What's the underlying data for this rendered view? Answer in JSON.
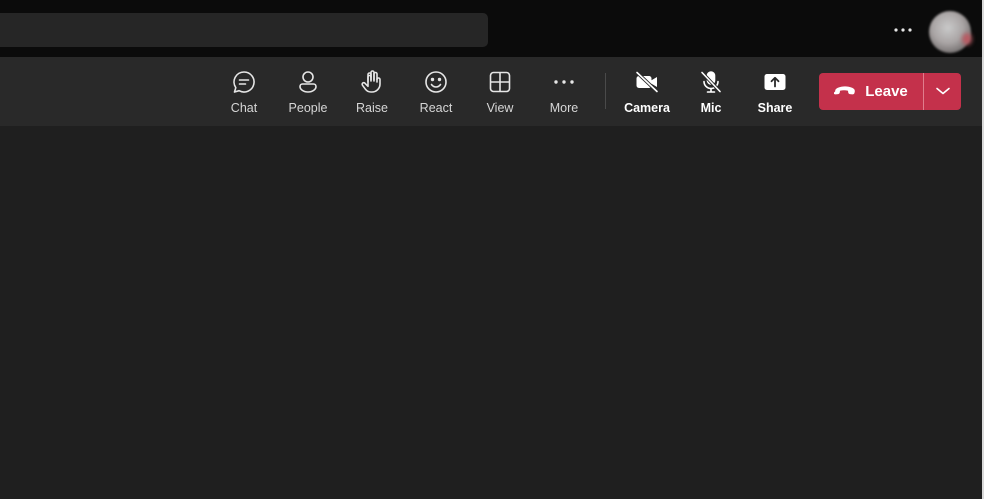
{
  "title_bar": {
    "search": {
      "value": "",
      "placeholder": ""
    },
    "more_icon": "ellipsis-icon",
    "avatar_icon": "profile-avatar"
  },
  "toolbar": {
    "tools": [
      {
        "label": "Chat",
        "icon": "chat-icon"
      },
      {
        "label": "People",
        "icon": "people-icon"
      },
      {
        "label": "Raise",
        "icon": "raise-hand-icon"
      },
      {
        "label": "React",
        "icon": "smiley-icon"
      },
      {
        "label": "View",
        "icon": "grid-view-icon"
      },
      {
        "label": "More",
        "icon": "ellipsis-icon"
      },
      {
        "label": "Camera",
        "icon": "camera-off-icon"
      },
      {
        "label": "Mic",
        "icon": "mic-off-icon"
      },
      {
        "label": "Share",
        "icon": "share-tray-icon"
      }
    ],
    "leave": {
      "label": "Leave",
      "icon": "hang-up-phone-icon",
      "dropdown_icon": "chevron-down-icon"
    }
  },
  "colors": {
    "title_bar": "#0b0b0b",
    "toolbar": "#292929",
    "stage": "#1f1f1f",
    "leave_button": "#c4314b"
  }
}
